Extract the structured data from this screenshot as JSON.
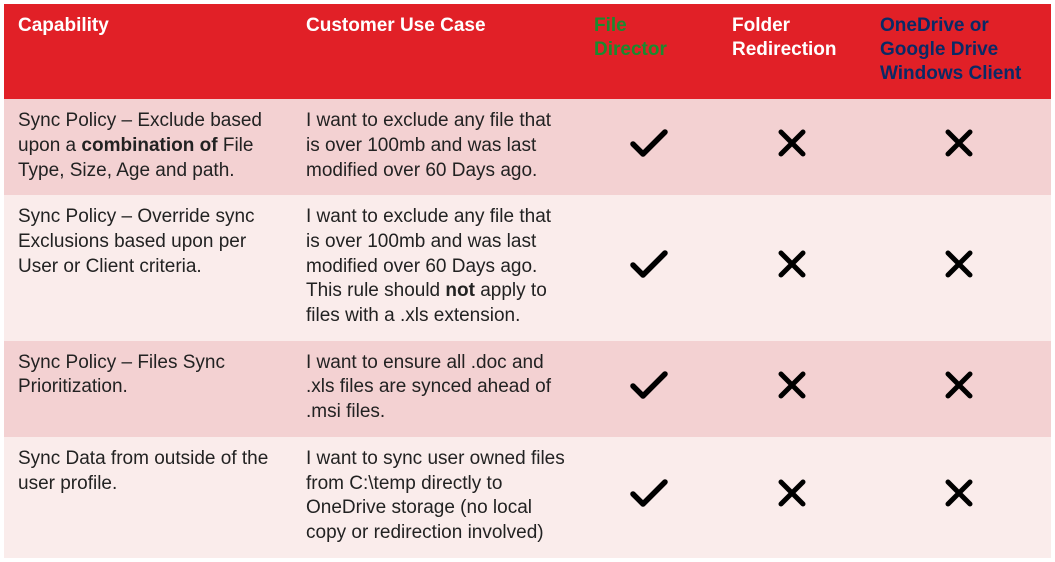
{
  "headers": {
    "capability": "Capability",
    "usecase": "Customer Use Case",
    "file_director": "File Director",
    "folder_redir": "Folder Redirection",
    "onedrive": "OneDrive or Google Drive Windows Client"
  },
  "rows": [
    {
      "capability_html": "Sync Policy – Exclude based upon a <b>combination of</b> File Type, Size, Age and path.",
      "usecase_html": "I want to exclude any file that is over 100mb and was last modified over 60 Days ago.",
      "file_director": true,
      "folder_redir": false,
      "onedrive": false
    },
    {
      "capability_html": "Sync Policy – Override sync Exclusions based upon per User or Client criteria.",
      "usecase_html": "I want to exclude any file that is over 100mb and was last modified over 60 Days ago. This rule should <b>not</b> apply to files with a .xls extension.",
      "file_director": true,
      "folder_redir": false,
      "onedrive": false
    },
    {
      "capability_html": "Sync Policy – Files Sync Prioritization.",
      "usecase_html": "I want to ensure all .doc and .xls files are synced ahead of .msi files.",
      "file_director": true,
      "folder_redir": false,
      "onedrive": false
    },
    {
      "capability_html": "Sync Data from outside of the user profile.",
      "usecase_html": "I want to sync user owned files from C:\\temp directly to OneDrive storage (no local copy or redirection involved)",
      "file_director": true,
      "folder_redir": false,
      "onedrive": false
    }
  ],
  "chart_data": {
    "type": "table",
    "columns": [
      "Capability",
      "Customer Use Case",
      "File Director",
      "Folder Redirection",
      "OneDrive or Google Drive Windows Client"
    ],
    "rows": [
      [
        "Sync Policy – Exclude based upon a combination of File Type, Size, Age and path.",
        "I want to exclude any file that is over 100mb and was last modified over 60 Days ago.",
        true,
        false,
        false
      ],
      [
        "Sync Policy – Override sync Exclusions based upon per User or Client criteria.",
        "I want to exclude any file that is over 100mb and was last modified over 60 Days ago. This rule should not apply to files with a .xls extension.",
        true,
        false,
        false
      ],
      [
        "Sync Policy – Files Sync Prioritization.",
        "I want to ensure all .doc and .xls files are synced ahead of .msi files.",
        true,
        false,
        false
      ],
      [
        "Sync Data from outside of the user profile.",
        "I want to sync user owned files from C:\\temp directly to OneDrive storage (no local copy or redirection involved)",
        true,
        false,
        false
      ]
    ]
  }
}
